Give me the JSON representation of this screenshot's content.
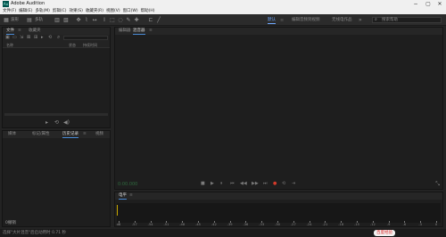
{
  "window": {
    "title": "Adobe Audition",
    "app_icon": "Au",
    "controls": {
      "minimize": "−",
      "maximize": "▢",
      "close": "✕"
    }
  },
  "menu": [
    "文件(F)",
    "编辑(E)",
    "多轨(M)",
    "剪辑(C)",
    "效果(S)",
    "收藏夹(R)",
    "视图(V)",
    "窗口(W)",
    "帮助(H)"
  ],
  "toolbar": {
    "waveform_label": "波形",
    "multitrack_label": "多轨",
    "workspaces": {
      "default": "默认",
      "edit_audio_video": "编辑音频到视频",
      "radio": "无线电作品"
    },
    "more": "»",
    "search_placeholder": "搜索帮助"
  },
  "files_panel": {
    "tabs": [
      "文件",
      "收藏夹"
    ],
    "tab_menu": "≡",
    "columns": {
      "name": "名称",
      "status": "状态",
      "duration": "持续时间"
    },
    "search_icon_glyph": "⌕"
  },
  "history_panel": {
    "tabs": [
      "媒体",
      "标记/属性",
      "历史记录",
      "视频"
    ],
    "tab_menu": "≡",
    "footer": "0撤销"
  },
  "editor_panel": {
    "tabs": [
      "编辑器",
      "混音器"
    ],
    "tab_menu": "≡",
    "timecode": "0:00.000",
    "transport": [
      "■",
      "▶",
      "⏸",
      "⏮",
      "◀◀",
      "▶▶",
      "⏭",
      "●",
      "⟲",
      "⇥"
    ]
  },
  "level_panel": {
    "title": "电平",
    "tab_menu": "≡",
    "scale": [
      "dB",
      "-57",
      "-54",
      "-51",
      "-48",
      "-45",
      "-42",
      "-39",
      "-36",
      "-33",
      "-30",
      "-27",
      "-24",
      "-21",
      "-18",
      "-15",
      "-12",
      "-9",
      "-6",
      "-3",
      "0"
    ]
  },
  "status": {
    "text": "选择\"大片混音\"后启动用时 0.71 秒",
    "badge": "百度经验"
  },
  "colors": {
    "accent_blue": "#4a8bd6",
    "record_red": "#d23a2a",
    "app_teal": "#00524b"
  }
}
